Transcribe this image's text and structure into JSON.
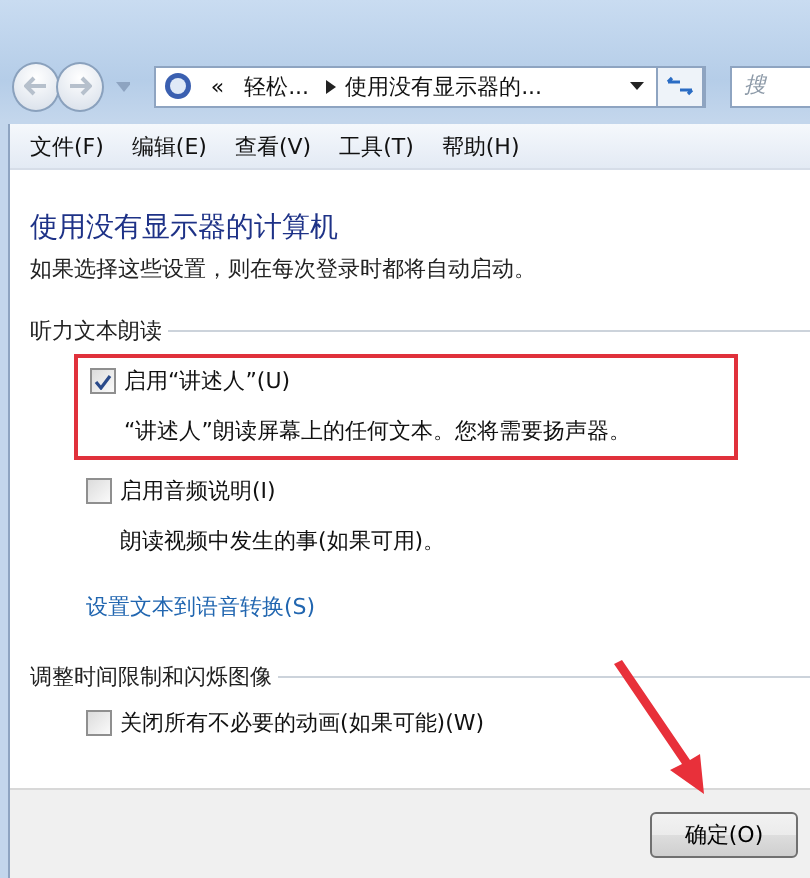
{
  "navigation": {
    "breadcrumbs": [
      {
        "text": "«",
        "kind": "chevron"
      },
      {
        "text": "轻松...",
        "kind": "crumb"
      },
      {
        "text": "使用没有显示器的...",
        "kind": "crumb"
      }
    ],
    "search": {
      "placeholder": "搜"
    }
  },
  "menu_bar": [
    "文件(F)",
    "编辑(E)",
    "查看(V)",
    "工具(T)",
    "帮助(H)"
  ],
  "heading": "使用没有显示器的计算机",
  "subtitle": "如果选择这些设置，则在每次登录时都将自动启动。",
  "sections": [
    {
      "title": "听力文本朗读",
      "items": [
        {
          "kind": "checkbox",
          "label": "启用“讲述人”(U)",
          "checked": true,
          "highlighted": true,
          "description": "“讲述人”朗读屏幕上的任何文本。您将需要扬声器。"
        },
        {
          "kind": "checkbox",
          "label": "启用音频说明(I)",
          "checked": false,
          "highlighted": false,
          "description": "朗读视频中发生的事(如果可用)。"
        },
        {
          "kind": "link",
          "label": "设置文本到语音转换(S)"
        }
      ]
    },
    {
      "title": "调整时间限制和闪烁图像",
      "items": [
        {
          "kind": "checkbox",
          "label": "关闭所有不必要的动画(如果可能)(W)",
          "checked": false,
          "highlighted": false
        }
      ]
    }
  ],
  "buttons": [
    "确定(O)"
  ]
}
